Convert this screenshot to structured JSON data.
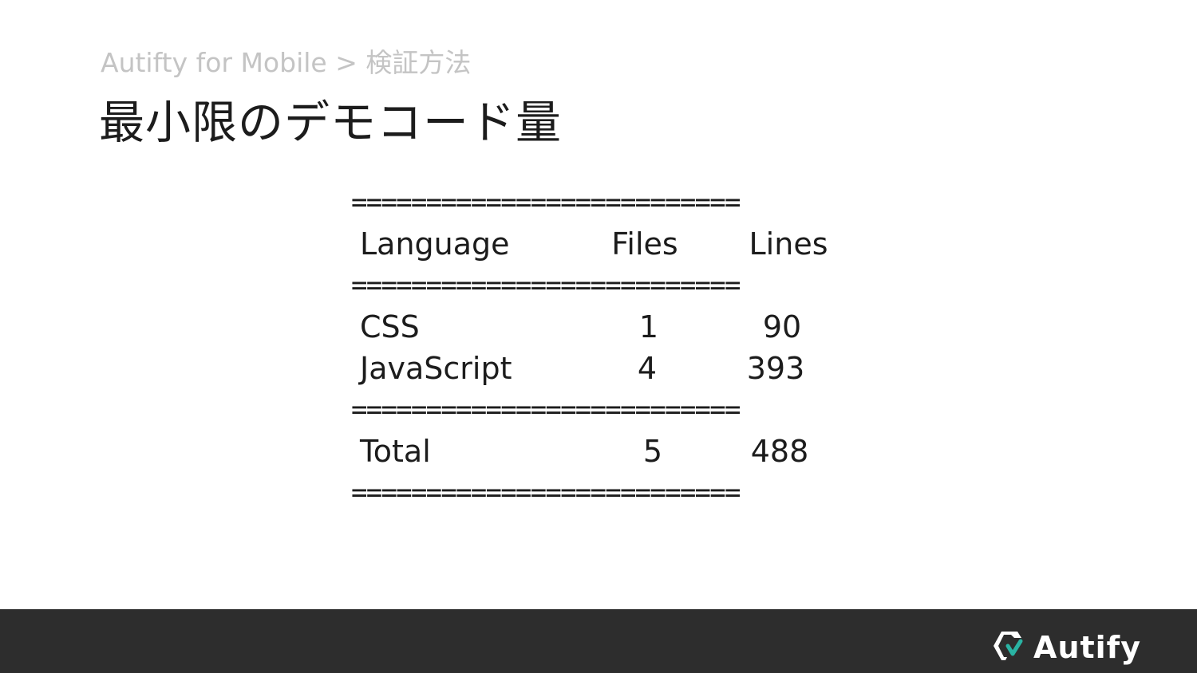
{
  "breadcrumb": "Autifty for Mobile > 検証方法",
  "title": "最小限のデモコード量",
  "report": {
    "separator": "==========================",
    "header": {
      "language": "Language",
      "files": "Files",
      "lines": "Lines"
    },
    "rows": [
      {
        "language": "CSS",
        "files": "1",
        "lines": "90"
      },
      {
        "language": "JavaScript",
        "files": "4",
        "lines": "393"
      }
    ],
    "total": {
      "language": "Total",
      "files": "5",
      "lines": "488"
    }
  },
  "footer": {
    "logo_text": "Autify",
    "logo_icon": "autify-logo-icon",
    "accent_color": "#2ab3a3",
    "background_color": "#2d2d2d"
  }
}
